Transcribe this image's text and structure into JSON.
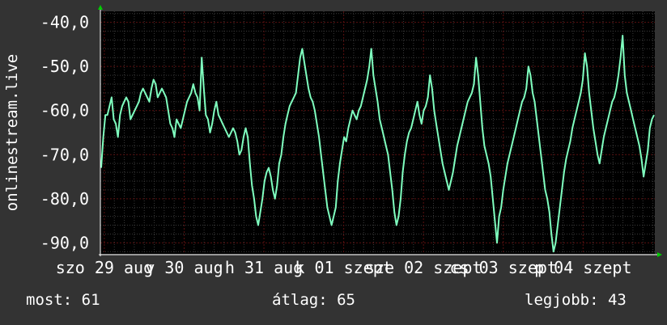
{
  "chart_data": {
    "type": "line",
    "ylabel": "onlinestream.live",
    "y_ticks": [
      "-40,0",
      "-50,0",
      "-60,0",
      "-70,0",
      "-80,0",
      "-90,0"
    ],
    "y_tick_values": [
      -40,
      -50,
      -60,
      -70,
      -80,
      -90
    ],
    "ylim": [
      -92.5,
      -37.5
    ],
    "x_ticks": [
      "szo 29 aug",
      "v 30 aug",
      "h 31 aug",
      "k 01 szept",
      "sze 02 szept",
      "cs 03 szept",
      "p 04 szept"
    ],
    "x_tick_values": [
      0,
      1,
      2,
      3,
      4,
      5,
      6
    ],
    "xlim": [
      -0.05,
      6.9
    ],
    "grid": true,
    "colors": {
      "background": "#333333",
      "plot": "#000000",
      "line": "#7fffbf",
      "grid_major": "#3a3a3a",
      "grid_minor": "#5a1010",
      "axis": "#ffffff",
      "arrow": "#00cc00"
    },
    "series": [
      {
        "values": [
          -73,
          -66,
          -61,
          -61,
          -59,
          -57,
          -62,
          -63,
          -66,
          -61,
          -59,
          -58,
          -57,
          -58,
          -62,
          -61,
          -60,
          -59,
          -58,
          -56,
          -55,
          -56,
          -57,
          -58,
          -55,
          -53,
          -54,
          -57,
          -56,
          -55,
          -56,
          -57,
          -60,
          -63,
          -64,
          -66,
          -62,
          -63,
          -64,
          -62,
          -60,
          -58,
          -57,
          -56,
          -54,
          -56,
          -57,
          -60,
          -48,
          -55,
          -61,
          -62,
          -65,
          -63,
          -60,
          -58,
          -61,
          -62,
          -63,
          -64,
          -65,
          -66,
          -65,
          -64,
          -65,
          -67,
          -70,
          -69,
          -66,
          -64,
          -66,
          -72,
          -77,
          -80,
          -84,
          -86,
          -83,
          -80,
          -76,
          -74,
          -73,
          -75,
          -78,
          -80,
          -77,
          -72,
          -70,
          -66,
          -63,
          -61,
          -59,
          -58,
          -57,
          -56,
          -52,
          -48,
          -46,
          -49,
          -52,
          -55,
          -57,
          -58,
          -60,
          -63,
          -66,
          -70,
          -74,
          -78,
          -82,
          -84,
          -86,
          -84,
          -82,
          -76,
          -72,
          -69,
          -66,
          -67,
          -64,
          -62,
          -60,
          -61,
          -62,
          -60,
          -59,
          -57,
          -55,
          -53,
          -50,
          -46,
          -52,
          -55,
          -58,
          -62,
          -64,
          -66,
          -68,
          -70,
          -74,
          -78,
          -83,
          -86,
          -84,
          -80,
          -74,
          -70,
          -67,
          -65,
          -64,
          -62,
          -60,
          -58,
          -61,
          -63,
          -60,
          -59,
          -57,
          -52,
          -55,
          -60,
          -63,
          -66,
          -69,
          -72,
          -74,
          -76,
          -78,
          -76,
          -74,
          -71,
          -68,
          -66,
          -64,
          -62,
          -60,
          -58,
          -57,
          -56,
          -54,
          -48,
          -52,
          -58,
          -64,
          -68,
          -70,
          -72,
          -75,
          -80,
          -85,
          -90,
          -84,
          -82,
          -78,
          -75,
          -72,
          -70,
          -68,
          -66,
          -64,
          -62,
          -60,
          -58,
          -57,
          -55,
          -50,
          -52,
          -56,
          -58,
          -62,
          -66,
          -70,
          -74,
          -78,
          -80,
          -83,
          -88,
          -92,
          -90,
          -86,
          -82,
          -78,
          -74,
          -71,
          -69,
          -67,
          -64,
          -62,
          -60,
          -58,
          -56,
          -53,
          -47,
          -50,
          -56,
          -60,
          -64,
          -67,
          -70,
          -72,
          -69,
          -66,
          -64,
          -62,
          -60,
          -58,
          -57,
          -55,
          -52,
          -48,
          -43,
          -52,
          -56,
          -58,
          -60,
          -62,
          -64,
          -66,
          -68,
          -71,
          -75,
          -72,
          -69,
          -64,
          -62,
          -61
        ]
      }
    ]
  },
  "stats": {
    "now": "most: 61",
    "avg": "átlag: 65",
    "max": "legjobb: 43"
  }
}
